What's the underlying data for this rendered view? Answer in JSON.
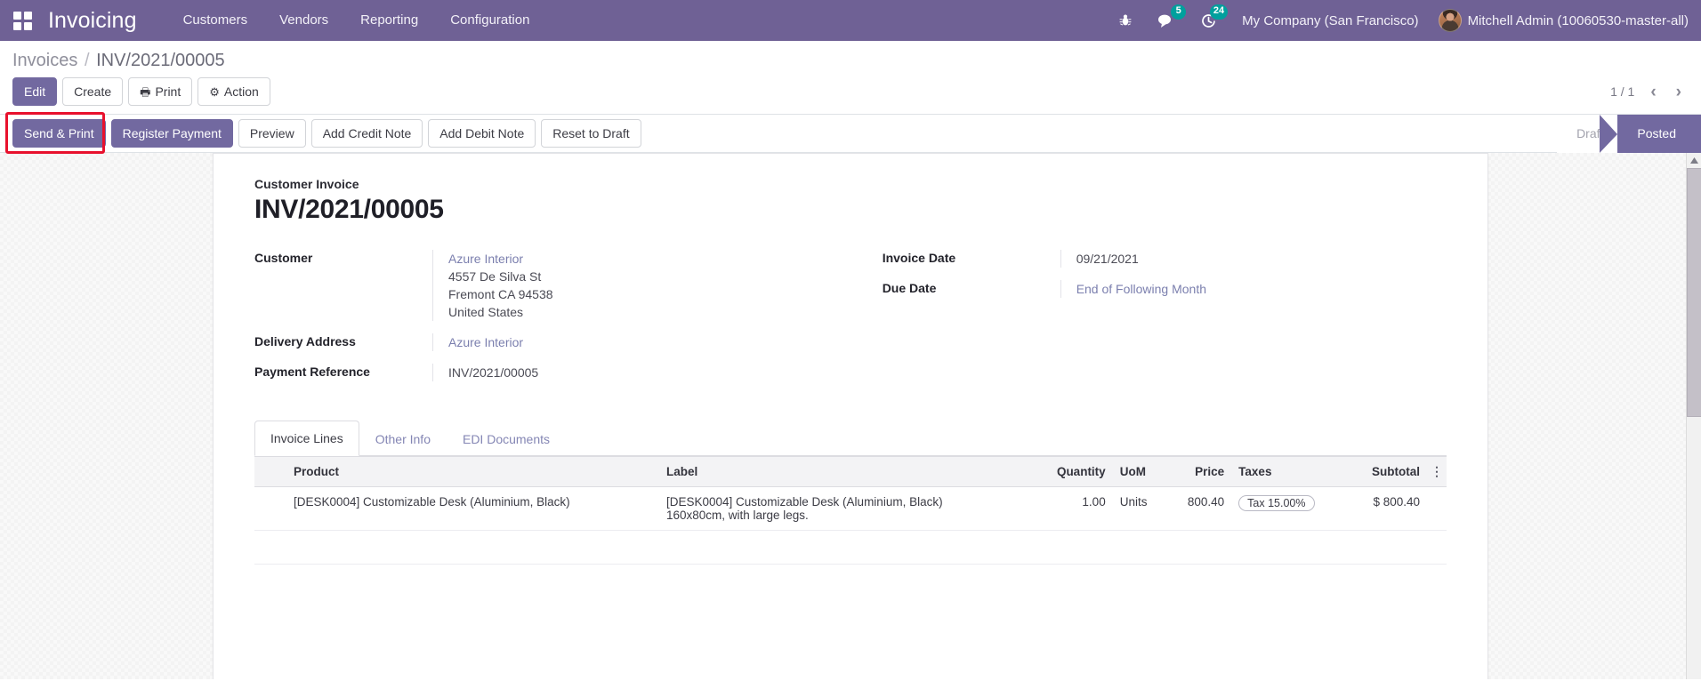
{
  "navbar": {
    "apps_icon": "apps-grid-icon",
    "brand": "Invoicing",
    "menu": [
      {
        "label": "Customers"
      },
      {
        "label": "Vendors"
      },
      {
        "label": "Reporting"
      },
      {
        "label": "Configuration"
      }
    ],
    "icons": {
      "debug": "bug-icon",
      "messages": "chat-bubble-icon",
      "activities": "clock-icon"
    },
    "messages_count": "5",
    "activities_count": "24",
    "company": "My Company (San Francisco)",
    "user": "Mitchell Admin (10060530-master-all)"
  },
  "control_panel": {
    "breadcrumb": {
      "root": "Invoices",
      "separator": "/",
      "current": "INV/2021/00005"
    },
    "buttons": [
      {
        "label": "Edit",
        "style": "primary",
        "icon": null
      },
      {
        "label": "Create",
        "style": "default",
        "icon": null
      },
      {
        "label": "Print",
        "style": "default",
        "icon": "printer-icon"
      },
      {
        "label": "Action",
        "style": "default",
        "icon": "gear-icon"
      }
    ],
    "pager": {
      "counter": "1 / 1",
      "previous": "‹",
      "next": "›"
    }
  },
  "status_row": {
    "action_buttons": [
      {
        "label": "Send & Print",
        "style": "primary",
        "highlighted": true
      },
      {
        "label": "Register Payment",
        "style": "primary",
        "highlighted": false
      },
      {
        "label": "Preview",
        "style": "default",
        "highlighted": false
      },
      {
        "label": "Add Credit Note",
        "style": "default",
        "highlighted": false
      },
      {
        "label": "Add Debit Note",
        "style": "default",
        "highlighted": false
      },
      {
        "label": "Reset to Draft",
        "style": "default",
        "highlighted": false
      }
    ],
    "statuses": [
      {
        "label": "Draft",
        "active": false
      },
      {
        "label": "Posted",
        "active": true
      }
    ]
  },
  "record": {
    "subtitle": "Customer Invoice",
    "title": "INV/2021/00005",
    "fields_left": [
      {
        "label": "Customer",
        "value_link": "Azure Interior",
        "address": [
          "4557 De Silva St",
          "Fremont CA 94538",
          "United States"
        ]
      },
      {
        "label": "Delivery Address",
        "value_link": "Azure Interior"
      },
      {
        "label": "Payment Reference",
        "value_text": "INV/2021/00005"
      }
    ],
    "fields_right": [
      {
        "label": "Invoice Date",
        "value_text": "09/21/2021"
      },
      {
        "label": "Due Date",
        "value_link": "End of Following Month"
      }
    ],
    "tabs": [
      {
        "label": "Invoice Lines",
        "active": true
      },
      {
        "label": "Other Info",
        "active": false
      },
      {
        "label": "EDI Documents",
        "active": false
      }
    ],
    "table": {
      "columns": [
        "Product",
        "Label",
        "Quantity",
        "UoM",
        "Price",
        "Taxes",
        "Subtotal"
      ],
      "options_icon": "options-vertical-icon",
      "rows": [
        {
          "product": "[DESK0004] Customizable Desk (Aluminium, Black)",
          "label_line1": "[DESK0004] Customizable Desk (Aluminium, Black)",
          "label_line2": "160x80cm, with large legs.",
          "quantity": "1.00",
          "uom": "Units",
          "price": "800.40",
          "taxes": "Tax 15.00%",
          "subtotal": "$ 800.40"
        }
      ]
    }
  },
  "colors": {
    "brand_purple": "#6f6195",
    "button_purple": "#7269a0",
    "badge_teal": "#00a09d",
    "highlight_red": "#e8112d",
    "link_purple": "#7b7fae"
  }
}
